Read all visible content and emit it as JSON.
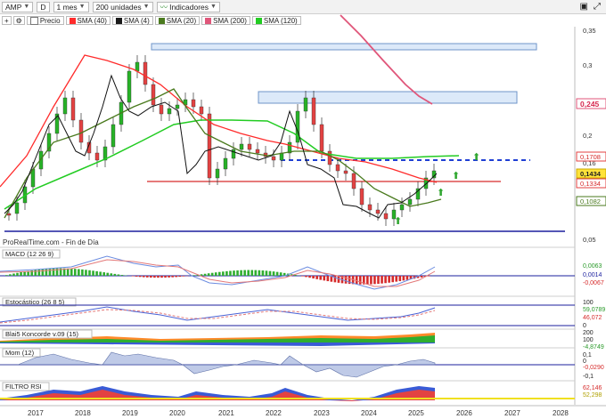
{
  "toolbar": {
    "symbol": "AMP",
    "timeframe_label": "1 mes",
    "units_label": "200 unidades",
    "indicators_label": "Indicadores"
  },
  "legend": {
    "items": [
      {
        "label": "Precio",
        "color": "#ffffff"
      },
      {
        "label": "SMA (40)",
        "color": "#ff2b2b"
      },
      {
        "label": "SMA (4)",
        "color": "#1a1a1a"
      },
      {
        "label": "SMA (20)",
        "color": "#4a7a1e"
      },
      {
        "label": "SMA (200)",
        "color": "#e0567a"
      },
      {
        "label": "SMA (120)",
        "color": "#22cc22"
      }
    ]
  },
  "price_axis": {
    "ticks": [
      "0,35",
      "0,3",
      "0,2",
      "0,16",
      "0,15",
      "0,05"
    ],
    "label_sma200": "0,245",
    "label_sma120": "0,1708",
    "label_price": "0,1434",
    "label_sma40": "0,1334",
    "label_sma20": "0,1082"
  },
  "footer": "ProRealTime.com - Fin de Día",
  "panels": {
    "macd": {
      "title": "MACD (12 26 9)",
      "labels": [
        "0,0063",
        "0,0014",
        "-0,0067"
      ]
    },
    "stoch": {
      "title": "Estocástico (26 8 5)",
      "labels": [
        "100",
        "59,0789",
        "46,072",
        "0"
      ]
    },
    "blai5": {
      "title": "Blai5 Koncorde v.09 (15)",
      "labels": [
        "200",
        "100",
        "-4,8749"
      ]
    },
    "mom": {
      "title": "Mom (12)",
      "labels": [
        "0,1",
        "0",
        "-0,0290",
        "-0,1"
      ]
    },
    "rsi": {
      "title": "FILTRO RSI",
      "labels": [
        "62,146",
        "52,298"
      ]
    }
  },
  "x_axis": {
    "years": [
      "2017",
      "2018",
      "2019",
      "2020",
      "2021",
      "2022",
      "2023",
      "2024",
      "2025",
      "2026",
      "2027",
      "2028"
    ]
  },
  "colors": {
    "sma40": "#ff2b2b",
    "sma4": "#1a1a1a",
    "sma20": "#4a7a1e",
    "sma200": "#e0567a",
    "sma120": "#22cc22",
    "bull": "#27b227",
    "bear": "#e34242",
    "support": "#1b1f9e",
    "resistance_zone": "#cde0f7"
  },
  "chart_data": {
    "type": "line",
    "x": [
      "2017",
      "2018",
      "2019",
      "2020",
      "2021",
      "2022",
      "2023",
      "2024",
      "2025"
    ],
    "series": [
      {
        "name": "SMA (40)",
        "values": [
          null,
          0.22,
          0.225,
          0.205,
          0.185,
          0.175,
          0.16,
          0.145,
          0.135
        ]
      },
      {
        "name": "SMA (20)",
        "values": [
          null,
          0.17,
          0.19,
          0.215,
          0.17,
          0.175,
          0.15,
          0.105,
          0.11
        ]
      },
      {
        "name": "SMA (120)",
        "values": [
          null,
          null,
          0.16,
          0.19,
          0.19,
          0.175,
          0.168,
          0.17,
          0.171
        ]
      },
      {
        "name": "SMA (200)",
        "values": [
          null,
          null,
          null,
          null,
          null,
          null,
          0.34,
          0.3,
          0.245
        ]
      }
    ],
    "last_values": {
      "price": 0.1434,
      "sma200": 0.245,
      "sma120": 0.1708,
      "sma40": 0.1334,
      "sma20": 0.1082
    },
    "ylim": [
      0.05,
      0.35
    ]
  }
}
